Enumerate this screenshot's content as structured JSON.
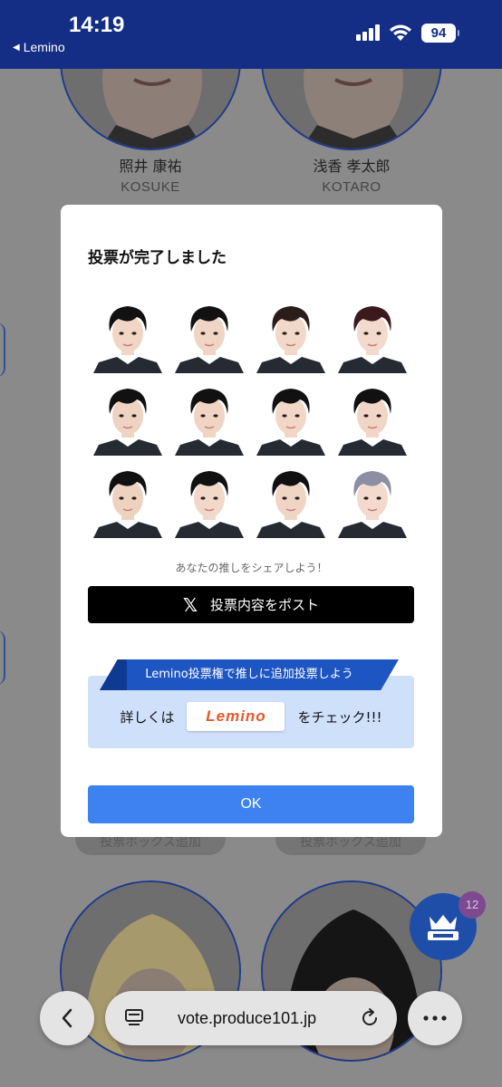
{
  "status_bar": {
    "time": "14:19",
    "back_app": "Lemino",
    "battery": "94"
  },
  "background": {
    "contestants": [
      {
        "name_ja": "照井 康祐",
        "name_en": "KOSUKE"
      },
      {
        "name_ja": "浅香 孝太郎",
        "name_en": "KOTARO"
      }
    ],
    "vote_box_button": "投票ボックス追加"
  },
  "ranking_badge": "12",
  "modal": {
    "title": "投票が完了しました",
    "share_caption": "あなたの推しをシェアしよう！",
    "post_button": "投票内容をポスト",
    "post_icon": "𝕏",
    "lemino": {
      "ribbon": "Lemino投票権で推しに追加投票しよう",
      "prefix": "詳しくは",
      "logo": "Lemino",
      "suffix": "をチェック!!!"
    },
    "ok_button": "OK"
  },
  "browser": {
    "url": "vote.produce101.jp"
  }
}
